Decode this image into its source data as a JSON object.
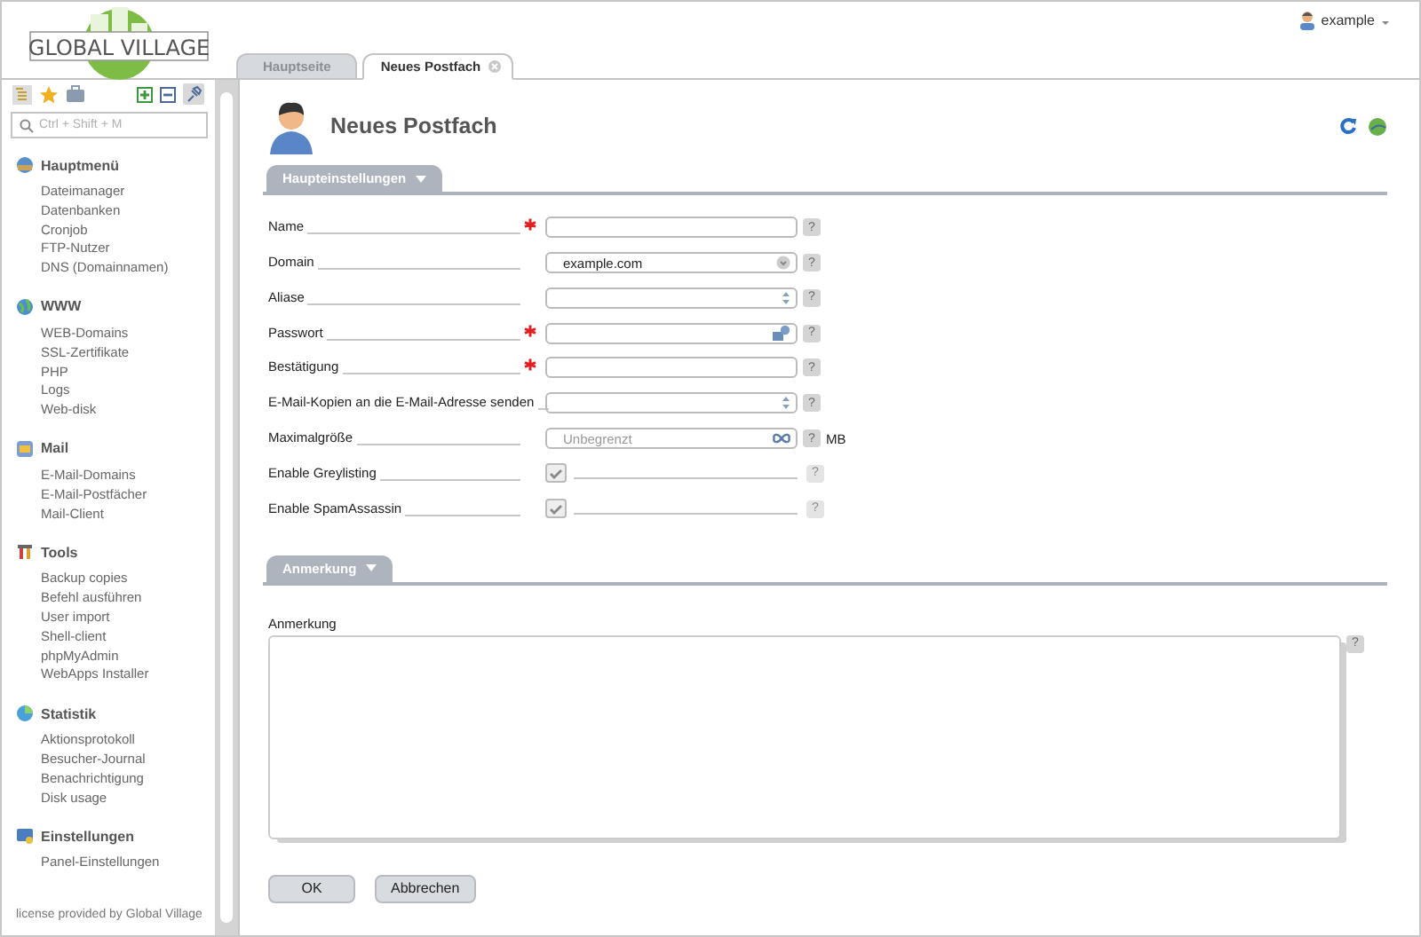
{
  "logo": {
    "text": "GLOBAL VILLAGE"
  },
  "user": {
    "name": "example"
  },
  "sidebar": {
    "search": {
      "placeholder": "Ctrl + Shift + M"
    },
    "sections": [
      {
        "title": "Hauptmenü",
        "kind": "home",
        "items": [
          "Dateimanager",
          "Datenbanken",
          "Cronjob",
          "FTP-Nutzer",
          "DNS (Domainnamen)"
        ]
      },
      {
        "title": "WWW",
        "kind": "web",
        "items": [
          "WEB-Domains",
          "SSL-Zertifikate",
          "PHP",
          "Logs",
          "Web-disk"
        ]
      },
      {
        "title": "Mail",
        "kind": "mail",
        "items": [
          "E-Mail-Domains",
          "E-Mail-Postfächer",
          "Mail-Client"
        ]
      },
      {
        "title": "Tools",
        "kind": "tools",
        "items": [
          "Backup copies",
          "Befehl ausführen",
          "User import",
          "Shell-client",
          "phpMyAdmin",
          "WebApps Installer"
        ]
      },
      {
        "title": "Statistik",
        "kind": "stats",
        "items": [
          "Aktionsprotokoll",
          "Besucher-Journal",
          "Benachrichtigung",
          "Disk usage"
        ]
      },
      {
        "title": "Einstellungen",
        "kind": "settings",
        "items": [
          "Panel-Einstellungen"
        ]
      }
    ],
    "footer": "license provided by Global Village"
  },
  "tabs": [
    {
      "label": "Hauptseite",
      "selected": false,
      "closable": false
    },
    {
      "label": "Neues Postfach",
      "selected": true,
      "closable": true
    }
  ],
  "page": {
    "title": "Neues Postfach"
  },
  "main_section": {
    "title": "Haupteinstellungen",
    "fields": [
      {
        "kind": "text",
        "label": "Name",
        "required": true,
        "help": "?"
      },
      {
        "kind": "select",
        "label": "Domain",
        "required": false,
        "value": "example.com",
        "help": "?"
      },
      {
        "kind": "spinner",
        "label": "Aliase",
        "required": false,
        "help": "?"
      },
      {
        "kind": "password",
        "label": "Passwort",
        "required": true,
        "help": "?"
      },
      {
        "kind": "text",
        "label": "Bestätigung",
        "required": true,
        "help": "?"
      },
      {
        "kind": "spinner",
        "label": "E-Mail-Kopien an die E-Mail-Adresse senden",
        "required": false,
        "help": "?"
      },
      {
        "kind": "size",
        "label": "Maximalgröße",
        "required": false,
        "placeholder": "Unbegrenzt",
        "unit": "MB",
        "help": "?"
      },
      {
        "kind": "checkbox",
        "label": "Enable Greylisting",
        "required": false,
        "checked": true,
        "help": "?"
      },
      {
        "kind": "checkbox",
        "label": "Enable SpamAssassin",
        "required": false,
        "checked": true,
        "help": "?"
      }
    ]
  },
  "note_section": {
    "title": "Anmerkung",
    "label": "Anmerkung",
    "help": "?"
  },
  "buttons": [
    "OK",
    "Abbrechen"
  ]
}
